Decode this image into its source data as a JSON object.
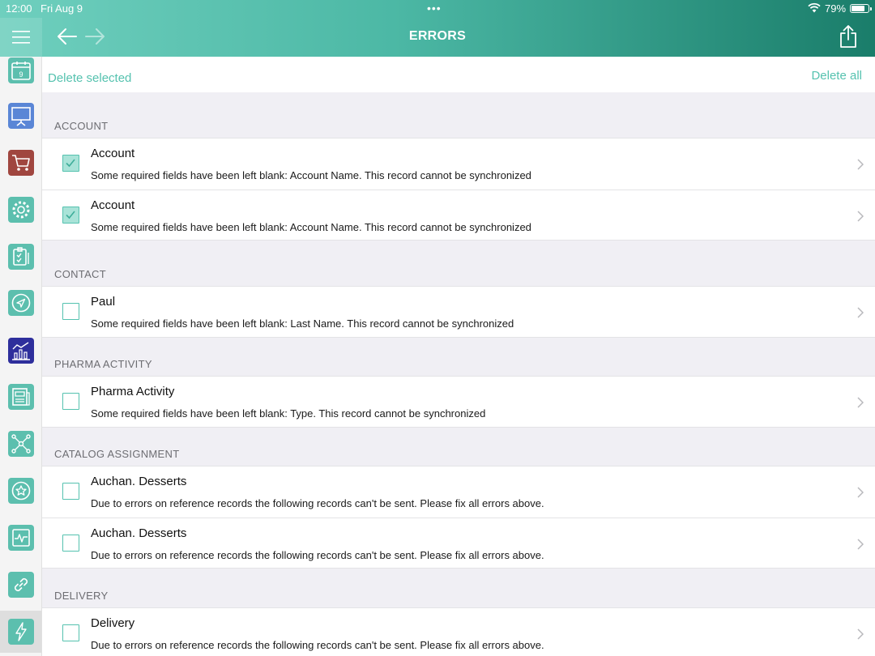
{
  "status_bar": {
    "time": "12:00",
    "date": "Fri Aug 9",
    "battery": "79%"
  },
  "header": {
    "title": "ERRORS"
  },
  "toolbar": {
    "delete_selected": "Delete selected",
    "delete_all": "Delete all"
  },
  "sidebar": {
    "items": [
      {
        "icon": "calendar-icon",
        "color": "#5cbfae"
      },
      {
        "icon": "presentation-icon",
        "color": "#5a86d6"
      },
      {
        "icon": "cart-icon",
        "color": "#a0463f"
      },
      {
        "icon": "gear-icon",
        "color": "#5cbfae"
      },
      {
        "icon": "clipboard-icon",
        "color": "#5cbfae"
      },
      {
        "icon": "navigation-icon",
        "color": "#5cbfae"
      },
      {
        "icon": "analytics-icon",
        "color": "#2e2f9c"
      },
      {
        "icon": "newspaper-icon",
        "color": "#5cbfae"
      },
      {
        "icon": "network-icon",
        "color": "#5cbfae"
      },
      {
        "icon": "star-icon",
        "color": "#5cbfae"
      },
      {
        "icon": "pulse-icon",
        "color": "#5cbfae"
      },
      {
        "icon": "link-icon",
        "color": "#5cbfae"
      },
      {
        "icon": "lightning-icon",
        "color": "#5cbfae"
      }
    ],
    "calendar_day": "9"
  },
  "sections": [
    {
      "header": "ACCOUNT",
      "rows": [
        {
          "title": "Account",
          "message": "Some required fields have been left blank: Account Name. This record cannot be synchronized",
          "checked": true
        },
        {
          "title": "Account",
          "message": "Some required fields have been left blank: Account Name. This record cannot be synchronized",
          "checked": true
        }
      ]
    },
    {
      "header": "CONTACT",
      "rows": [
        {
          "title": "Paul",
          "message": "Some required fields have been left blank: Last Name. This record cannot be synchronized",
          "checked": false
        }
      ]
    },
    {
      "header": "PHARMA ACTIVITY",
      "rows": [
        {
          "title": "Pharma Activity",
          "message": "Some required fields have been left blank: Type. This record cannot be synchronized",
          "checked": false
        }
      ]
    },
    {
      "header": "CATALOG ASSIGNMENT",
      "rows": [
        {
          "title": "Auchan. Desserts",
          "message": "Due to errors on reference records the following records can't be sent. Please fix all errors above.",
          "checked": false
        },
        {
          "title": "Auchan. Desserts",
          "message": "Due to errors on reference records the following records can't be sent. Please fix all errors above.",
          "checked": false
        }
      ]
    },
    {
      "header": "DELIVERY",
      "rows": [
        {
          "title": "Delivery",
          "message": "Due to errors on reference records the following records can't be sent. Please fix all errors above.",
          "checked": false
        }
      ]
    }
  ],
  "colors": {
    "accent": "#55c2af",
    "header_start": "#6fcfbe",
    "header_end": "#1a7d6a"
  }
}
